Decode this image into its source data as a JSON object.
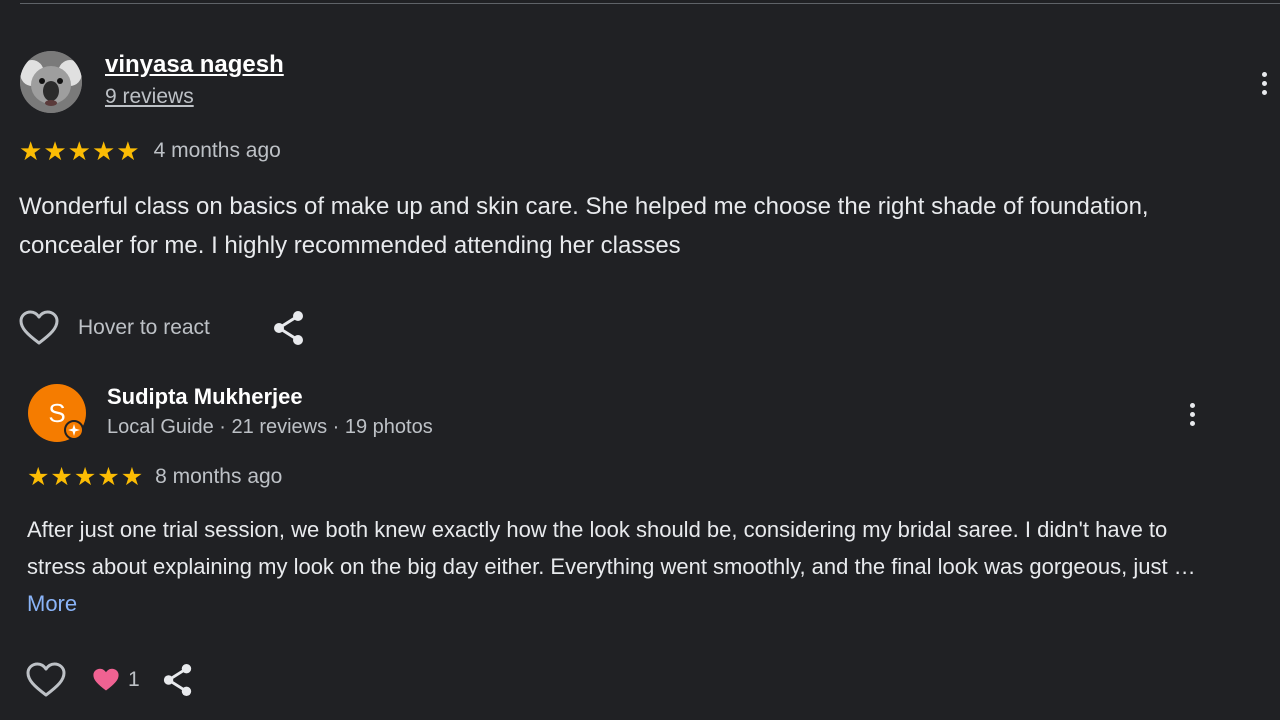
{
  "reviews": [
    {
      "author": "vinyasa nagesh",
      "subline": "9 reviews",
      "rating": 5,
      "stars": [
        "★",
        "★",
        "★",
        "★",
        "★"
      ],
      "date": "4 months ago",
      "text": "Wonderful class on basics of make up and skin care. She helped me choose the right shade of foundation, concealer for me. I highly recommended attending her classes",
      "react_label": "Hover to react"
    },
    {
      "author": "Sudipta Mukherjee",
      "avatar_letter": "S",
      "subline": "Local Guide · 21 reviews · 19 photos",
      "rating": 5,
      "stars": [
        "★",
        "★",
        "★",
        "★",
        "★"
      ],
      "date": "8 months ago",
      "text": "After just one trial session, we both knew exactly how the look should be, considering my bridal saree. I didn't have to stress about explaining my look on the big day either. Everything went smoothly, and the final look was gorgeous, just …",
      "more_label": "More",
      "reaction_count": "1"
    }
  ],
  "colors": {
    "background": "#202124",
    "star": "#fbbc04",
    "avatar_orange": "#f57c00",
    "link_blue": "#8ab4f8",
    "reaction_heart": "#f06292"
  },
  "icons": {
    "like": "heart-outline-icon",
    "share": "share-icon",
    "menu": "more-vert-icon",
    "reaction": "heart-filled-icon",
    "badge": "local-guide-badge-icon"
  }
}
